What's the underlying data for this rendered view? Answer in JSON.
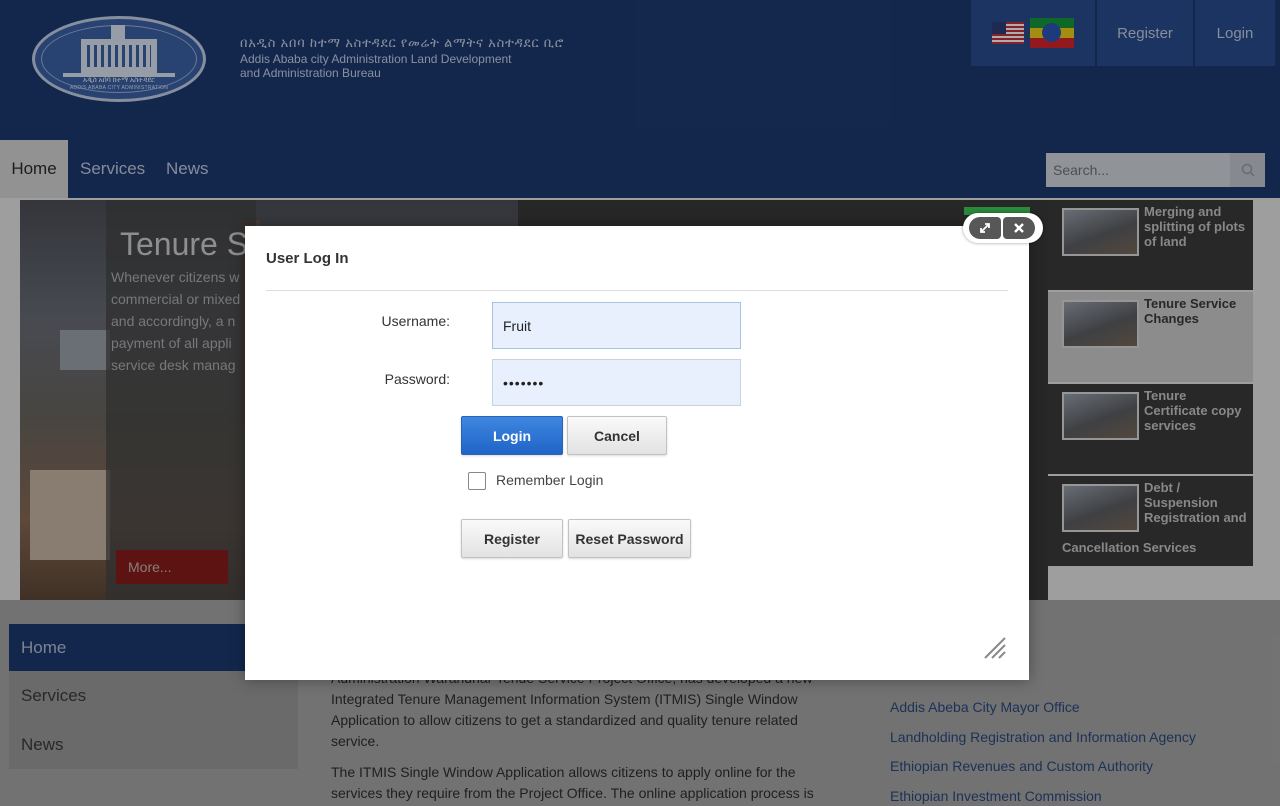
{
  "header": {
    "logo_text_amharic": "አዲስ አበባ ከተማ አስተዳደር",
    "logo_text_english": "ADDIS ABABA CITY ADMINISTRATION",
    "org_amharic": "በአዲስ አበባ ከተማ አስተዳደር የመሬት ልማትና አስተዳደር ቢሮ",
    "org_line1": "Addis Ababa city Administration Land Development",
    "org_line2": "and Administration Bureau",
    "register": "Register",
    "login": "Login"
  },
  "nav": {
    "home": "Home",
    "services": "Services",
    "news": "News",
    "search_placeholder": "Search..."
  },
  "hero": {
    "title": "Tenure S",
    "lines": [
      "Whenever citizens w",
      "commercial or mixed",
      "and accordingly, a n",
      "payment of all appli",
      "service desk manag"
    ],
    "more": "More..."
  },
  "services": [
    "Merging and splitting of plots of land",
    "Tenure Service Changes",
    "Tenure Certificate copy services",
    "Debt / Suspension Registration and",
    "Cancellation Services"
  ],
  "sidebar": {
    "items": [
      "Home",
      "Services",
      "News"
    ]
  },
  "article": {
    "p1": "Administration Warandnar Tende Service Project Office, has developed a new Integrated Tenure Management Information System (ITMIS) Single Window Application to allow citizens to get a standardized and quality tenure related service.",
    "p2": "The ITMIS Single Window Application allows citizens to apply online for the services they require from the Project Office. The online application process is"
  },
  "links": [
    "Addis Abeba City Mayor Office",
    "Landholding Registration and Information Agency",
    "Ethiopian Revenues and Custom Authority",
    "Ethiopian Investment Commission"
  ],
  "modal": {
    "title": "User Log In",
    "username_label": "Username:",
    "username_value": "Fruit",
    "password_label": "Password:",
    "password_value": "•••••••",
    "login_button": "Login",
    "cancel_button": "Cancel",
    "remember_label": "Remember Login",
    "register_button": "Register",
    "reset_button": "Reset Password"
  },
  "icons": {
    "search": "search-icon",
    "maximize": "maximize-icon",
    "close": "close-icon",
    "resize": "resize-grip-icon"
  },
  "colors": {
    "header_bg": "#1d3a72",
    "primary_button": "#2a6fd6",
    "link": "#2a4a80"
  }
}
